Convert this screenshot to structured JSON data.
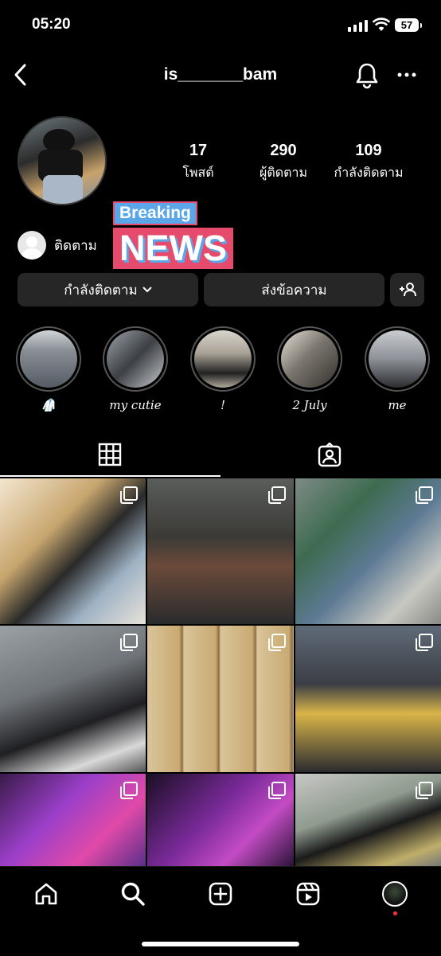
{
  "status_bar": {
    "time": "05:20",
    "battery": "57"
  },
  "header": {
    "username": "is_______bam"
  },
  "profile": {
    "stats": [
      {
        "value": "17",
        "label": "โพสต์"
      },
      {
        "value": "290",
        "label": "ผู้ติดตาม"
      },
      {
        "value": "109",
        "label": "กำลังติดตาม"
      }
    ],
    "followed_by_text": "ติดตาม",
    "sticker": {
      "top": "Breaking",
      "bottom": "NEWS"
    }
  },
  "actions": {
    "following_label": "กำลังติดตาม",
    "message_label": "ส่งข้อความ"
  },
  "highlights": [
    {
      "caption": "🥼"
    },
    {
      "caption": "my cutie"
    },
    {
      "caption": "!"
    },
    {
      "caption": "2 July"
    },
    {
      "caption": "me"
    }
  ],
  "tabs": [
    {
      "icon": "grid-icon"
    },
    {
      "icon": "tagged-icon"
    }
  ],
  "bottom_nav": [
    "home-icon",
    "search-icon",
    "create-icon",
    "reels-icon",
    "profile-avatar"
  ]
}
